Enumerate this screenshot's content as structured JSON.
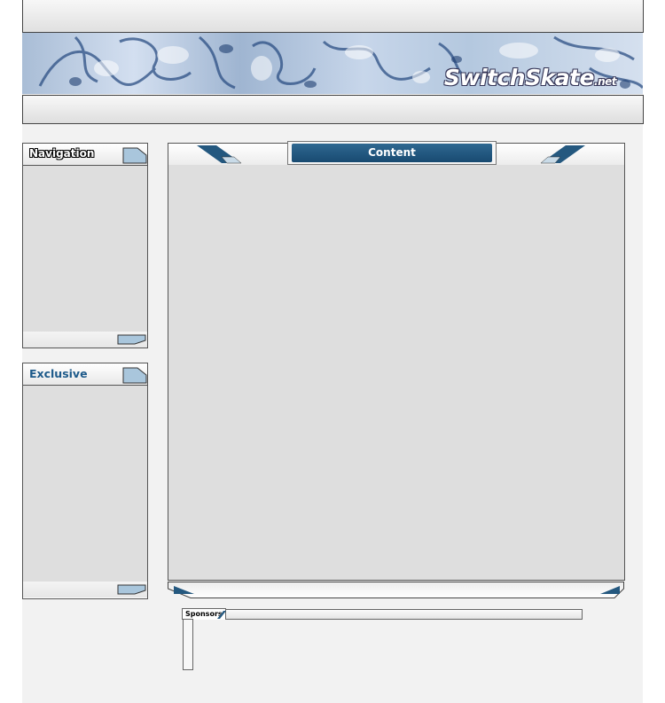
{
  "brand": {
    "name": "SwitchSkate",
    "suffix": ".net"
  },
  "navigation": {
    "title": "Navigation"
  },
  "exclusive": {
    "title": "Exclusive"
  },
  "content": {
    "title": "Content"
  },
  "sponsors": {
    "title": "Sponsors"
  },
  "colors": {
    "accent_dark_blue": "#184a71",
    "tab_light_blue": "#a9c6dc",
    "panel_gray": "#dedede",
    "page_background": "#f2f2f2"
  }
}
